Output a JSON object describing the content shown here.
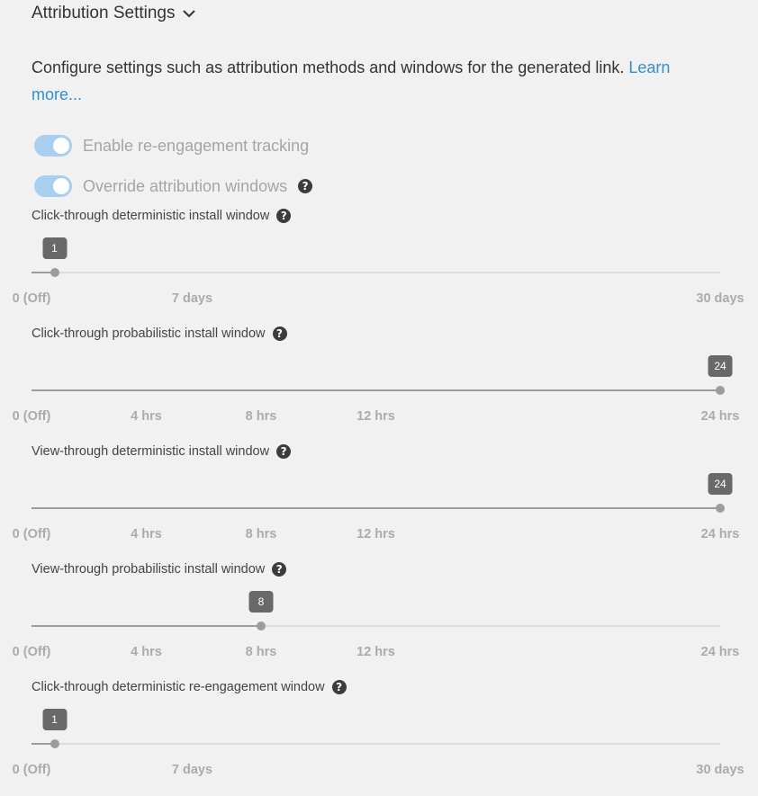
{
  "section": {
    "title": "Attribution Settings"
  },
  "description": {
    "text": "Configure settings such as attribution methods and windows for the generated link. ",
    "link": "Learn more..."
  },
  "toggles": [
    {
      "label": "Enable re-engagement tracking",
      "on": true
    },
    {
      "label": "Override attribution windows",
      "on": true
    }
  ],
  "colors": {
    "accent": "#2f8fd8",
    "toggle_track": "#a9cff0",
    "tooltip_bg": "#696969"
  },
  "sliders": [
    {
      "label": "Click-through deterministic install window",
      "value": "1",
      "value_num": 1,
      "min": 0,
      "max": 30,
      "ticks": [
        {
          "label": "0 (Off)",
          "v": 0
        },
        {
          "label": "7 days",
          "v": 7
        },
        {
          "label": "30 days",
          "v": 30
        }
      ]
    },
    {
      "label": "Click-through probabilistic install window",
      "value": "24",
      "value_num": 24,
      "min": 0,
      "max": 24,
      "ticks": [
        {
          "label": "0 (Off)",
          "v": 0
        },
        {
          "label": "4 hrs",
          "v": 4
        },
        {
          "label": "8 hrs",
          "v": 8
        },
        {
          "label": "12 hrs",
          "v": 12
        },
        {
          "label": "24 hrs",
          "v": 24
        }
      ]
    },
    {
      "label": "View-through deterministic install window",
      "value": "24",
      "value_num": 24,
      "min": 0,
      "max": 24,
      "ticks": [
        {
          "label": "0 (Off)",
          "v": 0
        },
        {
          "label": "4 hrs",
          "v": 4
        },
        {
          "label": "8 hrs",
          "v": 8
        },
        {
          "label": "12 hrs",
          "v": 12
        },
        {
          "label": "24 hrs",
          "v": 24
        }
      ]
    },
    {
      "label": "View-through probabilistic install window",
      "value": "8",
      "value_num": 8,
      "min": 0,
      "max": 24,
      "ticks": [
        {
          "label": "0 (Off)",
          "v": 0
        },
        {
          "label": "4 hrs",
          "v": 4
        },
        {
          "label": "8 hrs",
          "v": 8
        },
        {
          "label": "12 hrs",
          "v": 12
        },
        {
          "label": "24 hrs",
          "v": 24
        }
      ]
    },
    {
      "label": "Click-through deterministic re-engagement window",
      "value": "1",
      "value_num": 1,
      "min": 0,
      "max": 30,
      "ticks": [
        {
          "label": "0 (Off)",
          "v": 0
        },
        {
          "label": "7 days",
          "v": 7
        },
        {
          "label": "30 days",
          "v": 30
        }
      ]
    }
  ]
}
